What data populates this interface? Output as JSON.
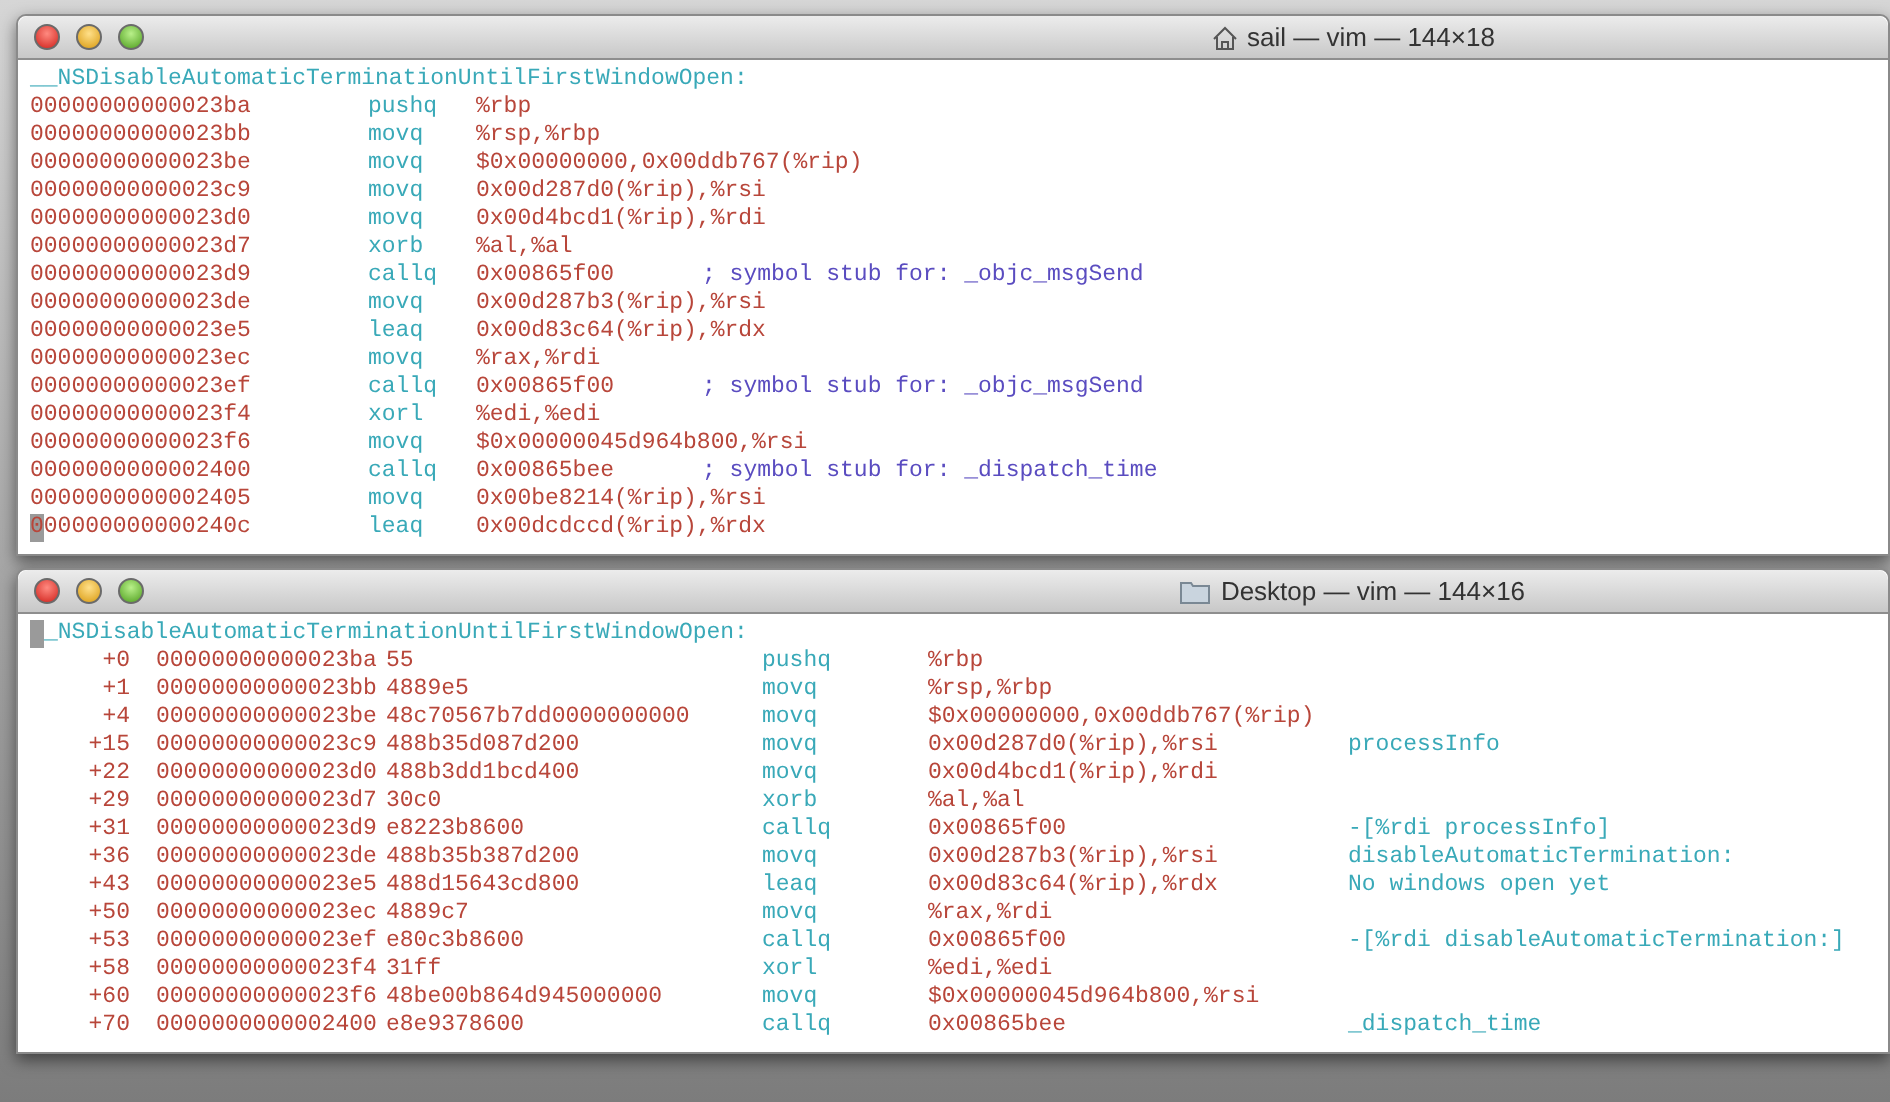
{
  "windows": [
    {
      "title": "sail — vim — 144×18",
      "title_icon": {
        "kind": "home"
      },
      "kind": "plain",
      "label": "__NSDisableAutomaticTerminationUntilFirstWindowOpen:",
      "label_cursor": false,
      "rows": [
        {
          "address": "00000000000023ba",
          "mnemonic": "pushq",
          "operands": "%rbp",
          "cursor": false
        },
        {
          "address": "00000000000023bb",
          "mnemonic": "movq",
          "operands": "%rsp,%rbp",
          "cursor": false
        },
        {
          "address": "00000000000023be",
          "mnemonic": "movq",
          "operands": "$0x00000000,0x00ddb767(%rip)",
          "cursor": false
        },
        {
          "address": "00000000000023c9",
          "mnemonic": "movq",
          "operands": "0x00d287d0(%rip),%rsi",
          "cursor": false
        },
        {
          "address": "00000000000023d0",
          "mnemonic": "movq",
          "operands": "0x00d4bcd1(%rip),%rdi",
          "cursor": false
        },
        {
          "address": "00000000000023d7",
          "mnemonic": "xorb",
          "operands": "%al,%al",
          "cursor": false
        },
        {
          "address": "00000000000023d9",
          "mnemonic": "callq",
          "operands": "0x00865f00",
          "comment": "; symbol stub for: _objc_msgSend",
          "cursor": false
        },
        {
          "address": "00000000000023de",
          "mnemonic": "movq",
          "operands": "0x00d287b3(%rip),%rsi",
          "cursor": false
        },
        {
          "address": "00000000000023e5",
          "mnemonic": "leaq",
          "operands": "0x00d83c64(%rip),%rdx",
          "cursor": false
        },
        {
          "address": "00000000000023ec",
          "mnemonic": "movq",
          "operands": "%rax,%rdi",
          "cursor": false
        },
        {
          "address": "00000000000023ef",
          "mnemonic": "callq",
          "operands": "0x00865f00",
          "comment": "; symbol stub for: _objc_msgSend",
          "cursor": false
        },
        {
          "address": "00000000000023f4",
          "mnemonic": "xorl",
          "operands": "%edi,%edi",
          "cursor": false
        },
        {
          "address": "00000000000023f6",
          "mnemonic": "movq",
          "operands": "$0x00000045d964b800,%rsi",
          "cursor": false
        },
        {
          "address": "0000000000002400",
          "mnemonic": "callq",
          "operands": "0x00865bee",
          "comment": "; symbol stub for: _dispatch_time",
          "cursor": false
        },
        {
          "address": "0000000000002405",
          "mnemonic": "movq",
          "operands": "0x00be8214(%rip),%rsi",
          "cursor": false
        },
        {
          "address": "000000000000240c",
          "mnemonic": "leaq",
          "operands": "0x00dcdccd(%rip),%rdx",
          "cursor": true
        }
      ]
    },
    {
      "title": "Desktop — vim — 144×16",
      "title_icon": {
        "kind": "folder"
      },
      "kind": "annotated",
      "label": "_NSDisableAutomaticTerminationUntilFirstWindowOpen:",
      "label_cursor": true,
      "rows": [
        {
          "offset": "+0",
          "address": "00000000000023ba",
          "bytes": "55",
          "mnemonic": "pushq",
          "operands": "%rbp",
          "cursor": false
        },
        {
          "offset": "+1",
          "address": "00000000000023bb",
          "bytes": "4889e5",
          "mnemonic": "movq",
          "operands": "%rsp,%rbp",
          "cursor": false
        },
        {
          "offset": "+4",
          "address": "00000000000023be",
          "bytes": "48c70567b7dd0000000000",
          "mnemonic": "movq",
          "operands": "$0x00000000,0x00ddb767(%rip)",
          "cursor": false
        },
        {
          "offset": "+15",
          "address": "00000000000023c9",
          "bytes": "488b35d087d200",
          "mnemonic": "movq",
          "operands": "0x00d287d0(%rip),%rsi",
          "comment": "processInfo",
          "cursor": false
        },
        {
          "offset": "+22",
          "address": "00000000000023d0",
          "bytes": "488b3dd1bcd400",
          "mnemonic": "movq",
          "operands": "0x00d4bcd1(%rip),%rdi",
          "cursor": false
        },
        {
          "offset": "+29",
          "address": "00000000000023d7",
          "bytes": "30c0",
          "mnemonic": "xorb",
          "operands": "%al,%al",
          "cursor": false
        },
        {
          "offset": "+31",
          "address": "00000000000023d9",
          "bytes": "e8223b8600",
          "mnemonic": "callq",
          "operands": "0x00865f00",
          "comment": "-[%rdi processInfo]",
          "cursor": false
        },
        {
          "offset": "+36",
          "address": "00000000000023de",
          "bytes": "488b35b387d200",
          "mnemonic": "movq",
          "operands": "0x00d287b3(%rip),%rsi",
          "comment": "disableAutomaticTermination:",
          "cursor": false
        },
        {
          "offset": "+43",
          "address": "00000000000023e5",
          "bytes": "488d15643cd800",
          "mnemonic": "leaq",
          "operands": "0x00d83c64(%rip),%rdx",
          "comment": "No windows open yet",
          "cursor": false
        },
        {
          "offset": "+50",
          "address": "00000000000023ec",
          "bytes": "4889c7",
          "mnemonic": "movq",
          "operands": "%rax,%rdi",
          "cursor": false
        },
        {
          "offset": "+53",
          "address": "00000000000023ef",
          "bytes": "e80c3b8600",
          "mnemonic": "callq",
          "operands": "0x00865f00",
          "comment": "-[%rdi disableAutomaticTermination:]",
          "cursor": false
        },
        {
          "offset": "+58",
          "address": "00000000000023f4",
          "bytes": "31ff",
          "mnemonic": "xorl",
          "operands": "%edi,%edi",
          "cursor": false
        },
        {
          "offset": "+60",
          "address": "00000000000023f6",
          "bytes": "48be00b864d945000000",
          "mnemonic": "movq",
          "operands": "$0x00000045d964b800,%rsi",
          "cursor": false
        },
        {
          "offset": "+70",
          "address": "0000000000002400",
          "bytes": "e8e9378600",
          "mnemonic": "callq",
          "operands": "0x00865bee",
          "comment": "_dispatch_time",
          "cursor": false
        }
      ]
    }
  ]
}
